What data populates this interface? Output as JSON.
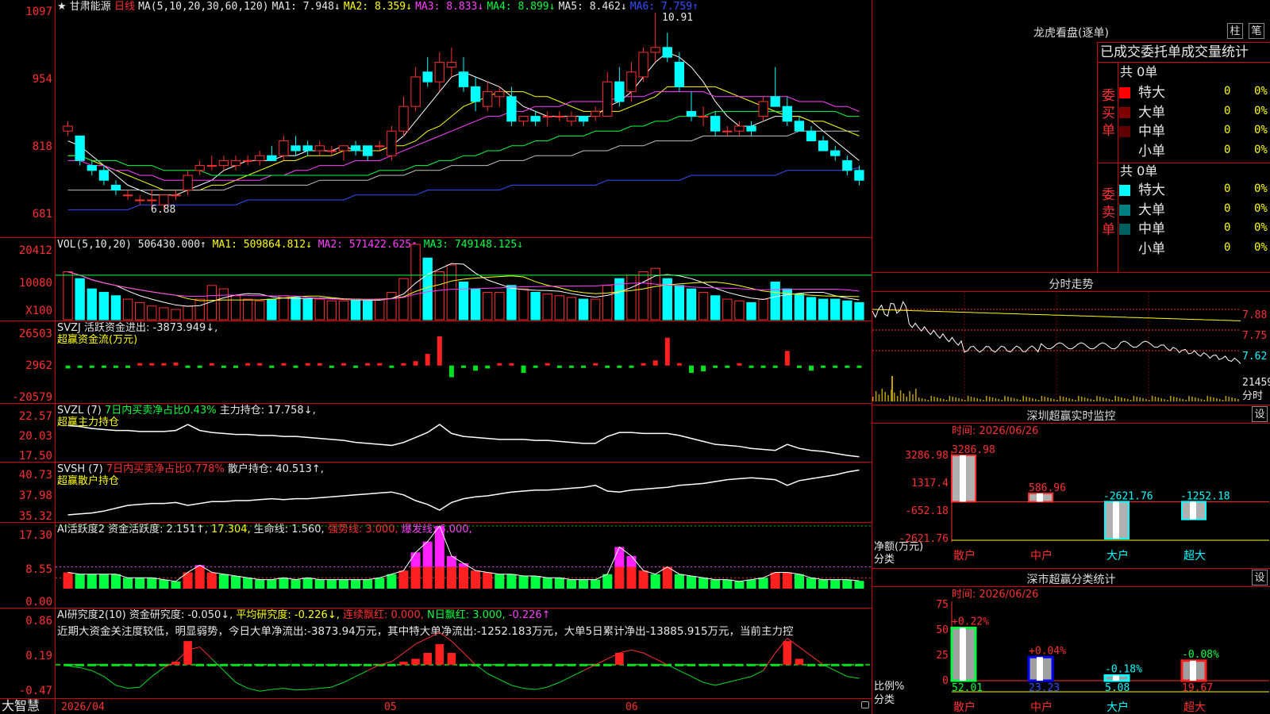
{
  "stock": {
    "star": "★",
    "name": "甘肃能源",
    "period": "日线"
  },
  "ma_header": {
    "params": "MA(5,10,20,30,60,120)",
    "ma1": "MA1: 7.948↓",
    "ma2": "MA2: 8.359↓",
    "ma3": "MA3: 8.833↓",
    "ma4": "MA4: 8.899↓",
    "ma5": "MA5: 8.462↓",
    "ma6": "MA6: 7.759↑"
  },
  "price_axis": [
    "1097",
    "954",
    "818",
    "681"
  ],
  "price_marks": {
    "high": "10.91",
    "low": "6.88"
  },
  "vol_header": {
    "params": "VOL(5,10,20)",
    "vol": "506430.000↑",
    "ma1": "MA1: 509864.812↓",
    "ma2": "MA2: 571422.625↑",
    "ma3": "MA3: 749148.125↓"
  },
  "vol_axis": [
    "20412",
    "10080",
    "X100"
  ],
  "svzj_header": {
    "a": "SVZJ  活跃资金进出: -3873.949↓,",
    "b": "超赢资金流(万元)"
  },
  "svzj_axis": [
    "26503",
    "2962",
    "-20579"
  ],
  "svzl_header": {
    "a": "SVZL (7)",
    "b": "7日内买卖净占比0.43%",
    "c": "主力持仓: 17.758↓,",
    "d": "超赢主力持仓"
  },
  "svzl_axis": [
    "22.57",
    "20.03",
    "17.50"
  ],
  "svsh_header": {
    "a": "SVSH (7)",
    "b": "7日内买卖净占比0.778%",
    "c": "散户持仓: 40.513↑,",
    "d": "超赢散户持仓"
  },
  "svsh_axis": [
    "40.73",
    "37.98",
    "35.32"
  ],
  "ai2_header": {
    "a": "AI活跃度2 资金活跃度: 2.151↑,",
    "b": "17.304,",
    "c": "生命线: 1.560,",
    "d": "强势线: 3.000,",
    "e": "爆发线: 6.000,"
  },
  "ai2_axis": [
    "17.30",
    "8.55",
    "0.00"
  ],
  "ai_header": {
    "a": "AI研究度2(10) 资金研究度: -0.050↓,",
    "b": "平均研究度: -0.226↓,",
    "c": "连续飘红: 0.000,",
    "d": "N日飘红: 3.000,",
    "e": "-0.226↑"
  },
  "ai_text": "近期大资金关注度较低，明显弱势，今日大单净流出:-3873.94万元，其中特大单净流出:-1252.183万元，大单5日累计净出-13885.915万元，当前主力控",
  "ai_axis": [
    "0.86",
    "0.19",
    "-0.47"
  ],
  "bottom": {
    "brand": "大智慧",
    "date": "2026/04",
    "m5": "05",
    "m6": "06"
  },
  "right": {
    "lhkp_title": "龙虎看盘(逐单)",
    "btn_zhu": "柱",
    "btn_bi": "笔",
    "tabs": "已成交委托单成交量统计",
    "buy": {
      "side": "委买单",
      "total": "共 0单",
      "rows": [
        {
          "name": "特大",
          "n": "0",
          "p": "0%",
          "color": "#ff0000"
        },
        {
          "name": "大单",
          "n": "0",
          "p": "0%",
          "color": "#800000"
        },
        {
          "name": "中单",
          "n": "0",
          "p": "0%",
          "color": "#600000"
        },
        {
          "name": "小单",
          "n": "0",
          "p": "0%",
          "color": "#000000"
        }
      ]
    },
    "sell": {
      "side": "委卖单",
      "total": "共 0单",
      "rows": [
        {
          "name": "特大",
          "n": "0",
          "p": "0%",
          "color": "#00ffff"
        },
        {
          "name": "大单",
          "n": "0",
          "p": "0%",
          "color": "#008080"
        },
        {
          "name": "中单",
          "n": "0",
          "p": "0%",
          "color": "#006060"
        },
        {
          "name": "小单",
          "n": "0",
          "p": "0%",
          "color": "#000000"
        }
      ]
    },
    "fs_title": "分时走势",
    "fs_axis": [
      "7.88",
      "7.75",
      "7.62",
      "21459",
      "分时"
    ],
    "rt_title": "深圳超赢实时监控",
    "rt_set": "设",
    "rt_time": "时间: 2026/06/26",
    "rt_axis": [
      "3286.98",
      "1317.4",
      "-652.18",
      "-2621.76"
    ],
    "rt_unit": "净额(万元)",
    "rt_cat": "分类",
    "rt_vals": [
      "3286.98",
      "586.96",
      "-2621.76",
      "-1252.18"
    ],
    "rt_cats": [
      "散户",
      "中户",
      "大户",
      "超大"
    ],
    "cls_title": "深市超赢分类统计",
    "cls_set": "设",
    "cls_time": "时间: 2026/06/26",
    "cls_axis": [
      "75",
      "50",
      "25",
      "0"
    ],
    "cls_unit": "比例%",
    "cls_cat": "分类",
    "cls_pct": [
      "+0.22%",
      "+0.04%",
      "-0.18%",
      "-0.08%"
    ],
    "cls_vals": [
      "52.01",
      "23.23",
      "5.08",
      "19.67"
    ],
    "cls_cats": [
      "散户",
      "中户",
      "大户",
      "超大"
    ]
  },
  "chart_data": {
    "type": "candlestick",
    "ylim": [
      6.81,
      10.97
    ],
    "candles": [
      [
        8.5,
        8.7,
        8.4,
        8.6
      ],
      [
        8.4,
        8.4,
        7.8,
        7.9
      ],
      [
        7.8,
        7.9,
        7.6,
        7.7
      ],
      [
        7.7,
        7.8,
        7.4,
        7.5
      ],
      [
        7.4,
        7.5,
        7.2,
        7.3
      ],
      [
        7.2,
        7.3,
        7.1,
        7.2
      ],
      [
        7.1,
        7.2,
        7.0,
        7.1
      ],
      [
        7.1,
        7.3,
        6.88,
        7.1
      ],
      [
        7.0,
        7.2,
        6.9,
        7.2
      ],
      [
        7.2,
        7.3,
        7.1,
        7.2
      ],
      [
        7.3,
        7.7,
        7.2,
        7.6
      ],
      [
        7.7,
        7.9,
        7.6,
        7.8
      ],
      [
        7.8,
        8.0,
        7.7,
        7.8
      ],
      [
        7.8,
        8.0,
        7.7,
        7.9
      ],
      [
        7.8,
        8.0,
        7.7,
        7.9
      ],
      [
        7.9,
        8.0,
        7.8,
        7.9
      ],
      [
        7.9,
        8.1,
        7.8,
        8.0
      ],
      [
        8.0,
        8.2,
        7.9,
        7.9
      ],
      [
        8.0,
        8.4,
        7.9,
        8.3
      ],
      [
        8.2,
        8.4,
        8.0,
        8.1
      ],
      [
        8.2,
        8.3,
        8.0,
        8.1
      ],
      [
        8.1,
        8.3,
        8.0,
        8.2
      ],
      [
        8.1,
        8.2,
        8.0,
        8.1
      ],
      [
        8.1,
        8.2,
        7.9,
        8.2
      ],
      [
        8.2,
        8.3,
        8.0,
        8.1
      ],
      [
        8.2,
        8.2,
        7.9,
        8.0
      ],
      [
        8.2,
        8.3,
        8.1,
        8.2
      ],
      [
        8.0,
        8.6,
        7.9,
        8.5
      ],
      [
        8.5,
        9.2,
        8.4,
        9.0
      ],
      [
        9.0,
        9.8,
        8.9,
        9.6
      ],
      [
        9.7,
        10.0,
        9.4,
        9.5
      ],
      [
        9.5,
        10.1,
        9.3,
        9.9
      ],
      [
        9.8,
        10.2,
        9.6,
        9.9
      ],
      [
        9.7,
        10.0,
        9.3,
        9.4
      ],
      [
        9.4,
        9.6,
        8.9,
        9.1
      ],
      [
        9.0,
        9.5,
        8.9,
        9.3
      ],
      [
        9.2,
        9.4,
        9.0,
        9.3
      ],
      [
        9.2,
        9.4,
        8.6,
        8.7
      ],
      [
        8.7,
        8.8,
        8.6,
        8.8
      ],
      [
        8.8,
        8.9,
        8.6,
        8.7
      ],
      [
        8.8,
        8.9,
        8.6,
        8.8
      ],
      [
        8.8,
        8.9,
        8.7,
        8.8
      ],
      [
        8.7,
        8.9,
        8.6,
        8.8
      ],
      [
        8.8,
        8.8,
        8.6,
        8.7
      ],
      [
        8.8,
        9.0,
        8.7,
        8.9
      ],
      [
        8.8,
        9.7,
        8.8,
        9.5
      ],
      [
        9.5,
        9.8,
        9.0,
        9.1
      ],
      [
        9.3,
        9.9,
        9.1,
        9.7
      ],
      [
        9.6,
        10.2,
        9.5,
        10.1
      ],
      [
        10.1,
        10.91,
        9.9,
        10.2
      ],
      [
        10.2,
        10.5,
        9.9,
        10.0
      ],
      [
        9.9,
        10.1,
        9.3,
        9.4
      ],
      [
        8.9,
        9.3,
        8.7,
        8.8
      ],
      [
        8.8,
        9.0,
        8.6,
        8.8
      ],
      [
        8.8,
        8.9,
        8.4,
        8.5
      ],
      [
        8.5,
        8.6,
        8.4,
        8.5
      ],
      [
        8.5,
        8.7,
        8.4,
        8.6
      ],
      [
        8.6,
        8.7,
        8.4,
        8.5
      ],
      [
        8.8,
        9.2,
        8.7,
        9.1
      ],
      [
        9.2,
        9.8,
        9.0,
        9.0
      ],
      [
        9.0,
        9.2,
        8.6,
        8.7
      ],
      [
        8.7,
        8.8,
        8.5,
        8.5
      ],
      [
        8.5,
        8.6,
        8.3,
        8.3
      ],
      [
        8.3,
        8.4,
        8.1,
        8.1
      ],
      [
        8.1,
        8.2,
        7.9,
        8.0
      ],
      [
        7.9,
        8.0,
        7.6,
        7.7
      ],
      [
        7.7,
        7.8,
        7.4,
        7.5
      ]
    ],
    "ma5": [
      8.3,
      8.2,
      8.0,
      7.8,
      7.6,
      7.4,
      7.3,
      7.2,
      7.2,
      7.2,
      7.3,
      7.4,
      7.5,
      7.7,
      7.8,
      7.9,
      7.9,
      7.9,
      8.0,
      8.0,
      8.1,
      8.1,
      8.1,
      8.2,
      8.1,
      8.1,
      8.1,
      8.2,
      8.4,
      8.7,
      9.0,
      9.3,
      9.6,
      9.7,
      9.6,
      9.5,
      9.4,
      9.2,
      9.0,
      8.9,
      8.8,
      8.8,
      8.8,
      8.8,
      8.8,
      9.0,
      9.1,
      9.3,
      9.6,
      9.9,
      10.1,
      10.0,
      9.8,
      9.5,
      9.1,
      8.8,
      8.6,
      8.6,
      8.7,
      8.8,
      8.8,
      8.8,
      8.7,
      8.5,
      8.3,
      8.1,
      7.9
    ],
    "ma10": [
      8.0,
      8.0,
      7.9,
      7.8,
      7.7,
      7.6,
      7.5,
      7.4,
      7.3,
      7.3,
      7.3,
      7.3,
      7.4,
      7.4,
      7.5,
      7.6,
      7.7,
      7.8,
      7.9,
      7.9,
      8.0,
      8.0,
      8.0,
      8.1,
      8.1,
      8.1,
      8.1,
      8.2,
      8.2,
      8.3,
      8.5,
      8.6,
      8.8,
      9.0,
      9.1,
      9.2,
      9.3,
      9.3,
      9.3,
      9.2,
      9.2,
      9.1,
      9.0,
      8.9,
      8.9,
      8.9,
      8.9,
      9.0,
      9.1,
      9.2,
      9.4,
      9.4,
      9.4,
      9.4,
      9.4,
      9.3,
      9.2,
      9.1,
      9.0,
      8.9,
      8.8,
      8.8,
      8.7,
      8.7,
      8.6,
      8.5,
      8.4
    ],
    "ma20": [
      7.9,
      7.9,
      7.8,
      7.8,
      7.7,
      7.7,
      7.6,
      7.6,
      7.5,
      7.5,
      7.5,
      7.5,
      7.5,
      7.5,
      7.5,
      7.5,
      7.5,
      7.6,
      7.6,
      7.7,
      7.7,
      7.8,
      7.8,
      7.8,
      7.9,
      7.9,
      7.9,
      8.0,
      8.1,
      8.2,
      8.3,
      8.4,
      8.5,
      8.6,
      8.7,
      8.8,
      8.8,
      8.9,
      8.9,
      9.0,
      9.0,
      9.0,
      9.1,
      9.1,
      9.1,
      9.1,
      9.2,
      9.2,
      9.2,
      9.3,
      9.3,
      9.3,
      9.3,
      9.3,
      9.2,
      9.2,
      9.2,
      9.2,
      9.2,
      9.2,
      9.2,
      9.1,
      9.1,
      9.1,
      9.0,
      9.0,
      8.9
    ],
    "ma30": [
      8.0,
      8.0,
      7.9,
      7.9,
      7.9,
      7.8,
      7.8,
      7.8,
      7.7,
      7.7,
      7.7,
      7.7,
      7.6,
      7.6,
      7.6,
      7.6,
      7.6,
      7.6,
      7.6,
      7.6,
      7.6,
      7.6,
      7.6,
      7.6,
      7.6,
      7.6,
      7.7,
      7.7,
      7.7,
      7.8,
      7.8,
      7.9,
      7.9,
      8.0,
      8.0,
      8.1,
      8.1,
      8.2,
      8.2,
      8.3,
      8.3,
      8.4,
      8.4,
      8.4,
      8.5,
      8.5,
      8.5,
      8.6,
      8.6,
      8.7,
      8.7,
      8.8,
      8.8,
      8.8,
      8.9,
      8.9,
      8.9,
      8.9,
      8.9,
      8.9,
      8.9,
      8.9,
      8.9,
      8.9,
      8.9,
      8.8,
      8.8
    ],
    "ma60": [
      7.3,
      7.3,
      7.3,
      7.3,
      7.3,
      7.3,
      7.3,
      7.3,
      7.3,
      7.3,
      7.3,
      7.3,
      7.3,
      7.3,
      7.4,
      7.4,
      7.4,
      7.4,
      7.4,
      7.4,
      7.4,
      7.5,
      7.5,
      7.5,
      7.5,
      7.5,
      7.6,
      7.6,
      7.6,
      7.7,
      7.7,
      7.7,
      7.8,
      7.8,
      7.8,
      7.8,
      7.9,
      7.9,
      7.9,
      8.0,
      8.0,
      8.0,
      8.0,
      8.1,
      8.1,
      8.1,
      8.2,
      8.2,
      8.2,
      8.3,
      8.3,
      8.3,
      8.3,
      8.4,
      8.4,
      8.4,
      8.4,
      8.4,
      8.4,
      8.4,
      8.4,
      8.5,
      8.5,
      8.5,
      8.5,
      8.5,
      8.5
    ],
    "ma120": [
      6.9,
      6.9,
      6.9,
      6.9,
      6.9,
      6.9,
      7.0,
      7.0,
      7.0,
      7.0,
      7.0,
      7.0,
      7.0,
      7.0,
      7.0,
      7.1,
      7.1,
      7.1,
      7.1,
      7.1,
      7.1,
      7.1,
      7.1,
      7.1,
      7.2,
      7.2,
      7.2,
      7.2,
      7.2,
      7.2,
      7.3,
      7.3,
      7.3,
      7.3,
      7.3,
      7.3,
      7.3,
      7.4,
      7.4,
      7.4,
      7.4,
      7.4,
      7.4,
      7.4,
      7.4,
      7.5,
      7.5,
      7.5,
      7.5,
      7.5,
      7.5,
      7.5,
      7.6,
      7.6,
      7.6,
      7.6,
      7.6,
      7.6,
      7.6,
      7.6,
      7.7,
      7.7,
      7.7,
      7.7,
      7.7,
      7.7,
      7.76
    ],
    "volume": [
      14000,
      12000,
      9000,
      8000,
      7000,
      6000,
      5000,
      4000,
      3500,
      3000,
      4000,
      6000,
      10000,
      9000,
      7000,
      6000,
      5500,
      6000,
      7000,
      6500,
      6000,
      6000,
      5500,
      5500,
      6000,
      5500,
      6000,
      8000,
      12000,
      22000,
      18000,
      14000,
      16000,
      11000,
      9000,
      8000,
      8000,
      10000,
      9000,
      8000,
      7500,
      7000,
      6500,
      6000,
      6000,
      10000,
      12000,
      13000,
      14000,
      15000,
      12000,
      10000,
      9000,
      8000,
      7000,
      6000,
      5500,
      5000,
      6000,
      11000,
      9000,
      7500,
      6500,
      6000,
      6000,
      5500,
      5000
    ],
    "svzj": [
      -2000,
      -1500,
      -1000,
      -1000,
      -500,
      -500,
      500,
      1000,
      1500,
      2000,
      -1500,
      -500,
      1000,
      -500,
      -500,
      500,
      1000,
      -1000,
      1500,
      -500,
      500,
      500,
      -500,
      500,
      -500,
      500,
      500,
      -1500,
      1000,
      3000,
      8000,
      20000,
      -8000,
      -1000,
      -3500,
      -2000,
      1500,
      1500,
      -5000,
      -1000,
      500,
      -500,
      -500,
      -1000,
      500,
      -500,
      -500,
      -500,
      1000,
      3500,
      19000,
      1500,
      -5000,
      -4000,
      -1000,
      -1000,
      500,
      -500,
      -500,
      -1000,
      10000,
      -500,
      -3500,
      -1000,
      -500,
      -1000,
      -1500
    ],
    "svzl": [
      20.9,
      20.8,
      20.6,
      20.5,
      20.4,
      20.4,
      20.3,
      20.3,
      20.3,
      20.4,
      21.0,
      20.4,
      20.2,
      20.1,
      20.0,
      20.0,
      19.9,
      19.9,
      19.8,
      19.8,
      19.7,
      19.6,
      19.5,
      19.4,
      19.2,
      19.1,
      19.0,
      18.9,
      19.2,
      19.7,
      20.2,
      21.0,
      20.1,
      19.8,
      19.7,
      19.6,
      19.5,
      19.5,
      19.5,
      19.4,
      19.4,
      19.3,
      19.2,
      19.1,
      19.1,
      19.8,
      20.2,
      20.2,
      20.1,
      20.1,
      20.1,
      19.9,
      19.6,
      19.3,
      19.0,
      18.9,
      18.8,
      18.6,
      18.5,
      18.4,
      19.0,
      18.6,
      18.4,
      18.3,
      18.1,
      17.9,
      17.76
    ],
    "svsh": [
      35.8,
      35.9,
      36.0,
      36.2,
      36.5,
      36.8,
      36.9,
      37.0,
      37.0,
      37.1,
      36.8,
      37.0,
      37.2,
      37.2,
      37.3,
      37.3,
      37.4,
      37.5,
      37.4,
      37.5,
      37.5,
      37.6,
      37.7,
      37.8,
      37.9,
      38.0,
      38.1,
      38.2,
      37.9,
      37.3,
      36.9,
      36.3,
      37.1,
      37.5,
      37.7,
      37.8,
      38.0,
      38.2,
      38.3,
      38.4,
      38.4,
      38.5,
      38.6,
      38.7,
      38.9,
      38.3,
      38.2,
      38.4,
      38.5,
      38.6,
      38.7,
      38.9,
      39.0,
      39.1,
      39.3,
      39.5,
      39.6,
      39.7,
      39.6,
      39.5,
      38.9,
      39.4,
      39.6,
      39.8,
      40.0,
      40.3,
      40.51
    ],
    "ai2": [
      4.5,
      4.0,
      4.0,
      4.0,
      4.0,
      3.0,
      3.0,
      3.0,
      2.5,
      2.0,
      4.5,
      6.5,
      4.5,
      4.0,
      3.5,
      3.0,
      2.5,
      2.5,
      3.0,
      2.5,
      3.0,
      2.5,
      2.5,
      2.5,
      2.5,
      2.5,
      3.0,
      4.0,
      5.0,
      10.0,
      13.0,
      17.3,
      9.0,
      7.0,
      5.0,
      4.5,
      4.0,
      4.0,
      3.5,
      3.5,
      3.0,
      3.0,
      2.5,
      2.5,
      2.5,
      4.0,
      11.5,
      9.0,
      5.0,
      4.0,
      6.0,
      4.0,
      3.5,
      3.0,
      2.5,
      2.5,
      2.0,
      2.5,
      3.0,
      4.5,
      4.5,
      4.0,
      3.0,
      2.5,
      2.5,
      2.5,
      2.15
    ],
    "ai_bars": [
      0,
      0,
      0,
      0,
      0,
      0,
      0,
      0,
      0,
      0.05,
      0.4,
      0,
      0,
      0,
      0,
      0,
      0,
      0,
      0,
      0,
      0,
      0,
      0,
      0,
      0,
      0,
      0,
      0,
      0.05,
      0.1,
      0.2,
      0.35,
      0.2,
      0,
      0,
      0,
      0,
      0,
      0,
      0,
      0,
      0,
      0,
      0,
      0,
      0,
      0.2,
      0,
      0,
      0,
      0,
      0,
      0,
      0,
      0,
      0,
      0,
      0,
      0,
      0,
      0.4,
      0.1,
      0,
      0,
      0,
      0,
      0
    ],
    "ai_line": [
      -0.02,
      -0.05,
      -0.1,
      -0.2,
      -0.35,
      -0.4,
      -0.38,
      -0.2,
      -0.05,
      0.05,
      0.25,
      0.3,
      0.1,
      -0.1,
      -0.3,
      -0.4,
      -0.45,
      -0.42,
      -0.4,
      -0.43,
      -0.42,
      -0.4,
      -0.38,
      -0.3,
      -0.2,
      -0.1,
      0.0,
      0.05,
      0.2,
      0.35,
      0.45,
      0.55,
      0.4,
      0.2,
      0.0,
      -0.15,
      -0.25,
      -0.35,
      -0.4,
      -0.42,
      -0.38,
      -0.3,
      -0.2,
      -0.1,
      0.0,
      0.1,
      0.2,
      0.25,
      0.2,
      0.1,
      0.0,
      -0.1,
      -0.2,
      -0.3,
      -0.35,
      -0.3,
      -0.25,
      -0.2,
      -0.1,
      0.2,
      0.45,
      0.3,
      0.15,
      0.0,
      -0.1,
      -0.2,
      -0.23
    ]
  }
}
